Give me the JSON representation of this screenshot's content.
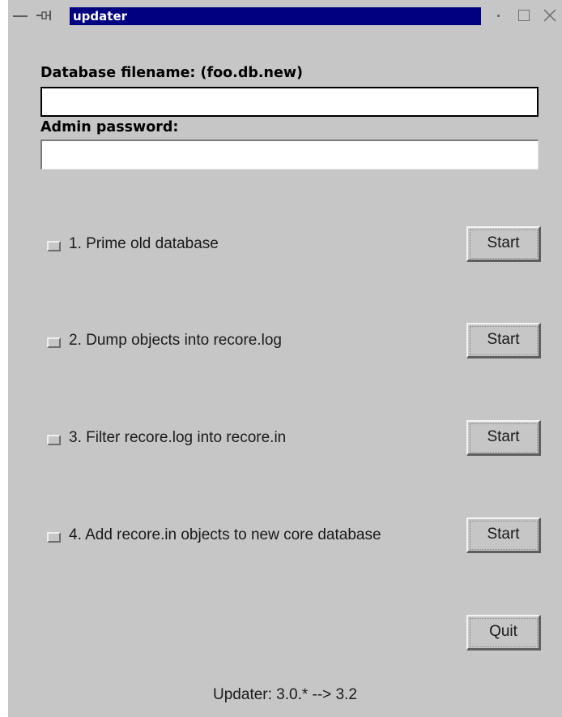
{
  "window": {
    "title": "updater"
  },
  "form": {
    "db_label": "Database filename: (foo.db.new)",
    "db_value": "",
    "password_label": "Admin password:",
    "password_value": ""
  },
  "steps": [
    {
      "label": "1. Prime old database",
      "button": "Start",
      "checked": false
    },
    {
      "label": "2. Dump objects into recore.log",
      "button": "Start",
      "checked": false
    },
    {
      "label": "3. Filter recore.log into recore.in",
      "button": "Start",
      "checked": false
    },
    {
      "label": "4. Add recore.in objects to new core database",
      "button": "Start",
      "checked": false
    }
  ],
  "quit_label": "Quit",
  "status": "Updater: 3.0.* --> 3.2",
  "colors": {
    "title_bar": "#000080",
    "window_bg": "#c6c6c6"
  },
  "icons": {
    "menu": "window-menu-icon",
    "pin": "pin-icon",
    "minimize": "minimize-icon",
    "maximize": "maximize-icon",
    "close": "close-icon"
  }
}
